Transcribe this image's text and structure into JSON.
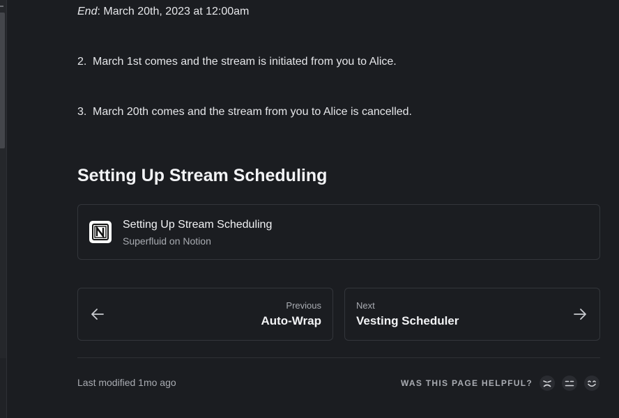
{
  "steps": {
    "end_label": "End",
    "end_value": ": March 20th, 2023 at 12:00am",
    "step2_num": "2.",
    "step2_text": "March 1st comes and the stream is initiated from you to Alice.",
    "step3_num": "3.",
    "step3_text": "March 20th comes and the stream from you to Alice is cancelled."
  },
  "section": {
    "heading": "Setting Up Stream Scheduling"
  },
  "embed": {
    "title": "Setting Up Stream Scheduling",
    "subtitle": "Superfluid on Notion",
    "icon": "notion-logo"
  },
  "pagination": {
    "previous_kicker": "Previous",
    "previous_title": "Auto-Wrap",
    "next_kicker": "Next",
    "next_title": "Vesting Scheduler"
  },
  "footer": {
    "last_modified": "Last modified 1mo ago",
    "helpful_label": "WAS THIS PAGE HELPFUL?",
    "feedback_icons": [
      "frown-face-icon",
      "neutral-face-icon",
      "smile-face-icon"
    ]
  },
  "colors": {
    "background": "#1b1d21",
    "text": "#e6e7ea",
    "muted": "#a9acb2",
    "border": "#33363b"
  }
}
